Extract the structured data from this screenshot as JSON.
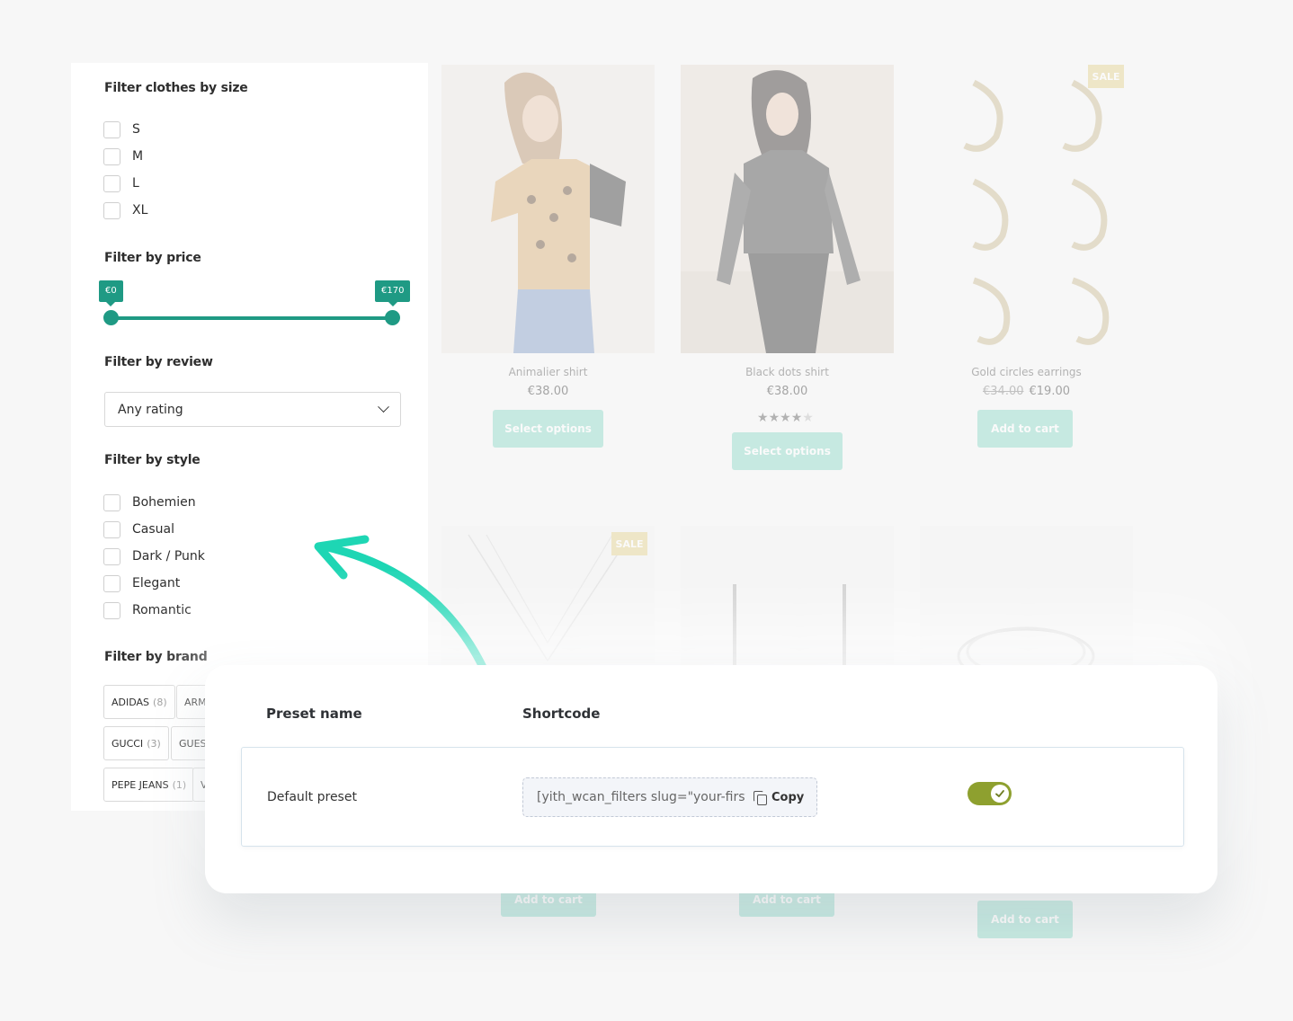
{
  "sidebar": {
    "size_filter": {
      "title": "Filter clothes by size",
      "options": [
        "S",
        "M",
        "L",
        "XL"
      ]
    },
    "price_filter": {
      "title": "Filter by price",
      "min_label": "€0",
      "max_label": "€170",
      "selected_range_fraction": [
        0,
        1
      ]
    },
    "review_filter": {
      "title": "Filter by review",
      "selected": "Any rating"
    },
    "style_filter": {
      "title": "Filter by style",
      "options": [
        "Bohemien",
        "Casual",
        "Dark / Punk",
        "Elegant",
        "Romantic"
      ]
    },
    "brand_filter": {
      "title": "Filter by brand",
      "tags": [
        {
          "name": "ADIDAS",
          "count": "(8)"
        },
        {
          "name": "ARM",
          "count": ""
        },
        {
          "name": "GUCCI",
          "count": "(3)"
        },
        {
          "name": "GUES",
          "count": ""
        },
        {
          "name": "PEPE JEANS",
          "count": "(1)"
        },
        {
          "name": "V",
          "count": ""
        }
      ]
    }
  },
  "products": {
    "items": [
      {
        "name": "Animalier shirt",
        "price": "€38.00",
        "old_price": "",
        "button": "Select options",
        "rating": null,
        "sale": false
      },
      {
        "name": "Black dots shirt",
        "price": "€38.00",
        "old_price": "",
        "button": "Select options",
        "rating": 4,
        "sale": false
      },
      {
        "name": "Gold circles earrings",
        "price": "€19.00",
        "old_price": "€34.00",
        "button": "Add to cart",
        "rating": null,
        "sale": true
      }
    ],
    "sale_badge": "SALE",
    "row2_buttons": [
      "Add to cart",
      "Add to cart",
      "Add to cart"
    ]
  },
  "panel": {
    "col_preset_name": "Preset name",
    "col_shortcode": "Shortcode",
    "row": {
      "name": "Default preset",
      "shortcode": "[yith_wcan_filters slug=\"your-first-preset\"]",
      "copy_label": "Copy",
      "enabled": true
    }
  },
  "colors": {
    "accent": "#1f9a84",
    "button": "#84d6c3",
    "toggle_on": "#8ea02f",
    "arrow": "#1ed6b4",
    "sale": "#e4cf86"
  },
  "icons": [
    "chevron-down-icon",
    "copy-icon",
    "check-icon",
    "star-icon",
    "arrow-icon"
  ]
}
